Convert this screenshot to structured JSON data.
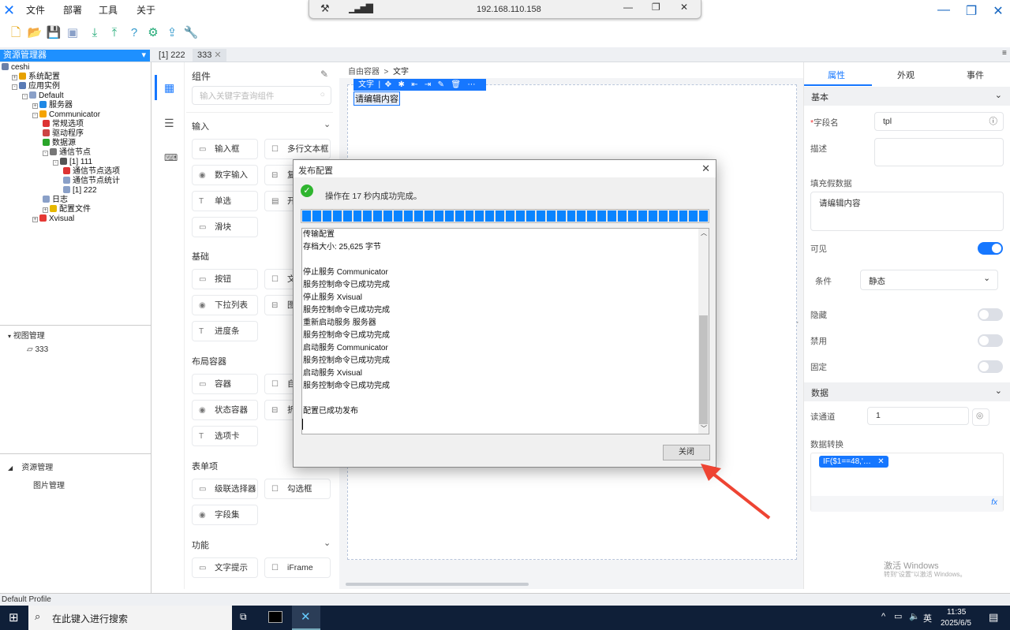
{
  "app": {
    "menus": [
      "文件",
      "部署",
      "工具",
      "关于"
    ],
    "accent": "#1677ff"
  },
  "remote": {
    "address": "192.168.110.158"
  },
  "explorer": {
    "title": "资源管理器",
    "tree": [
      {
        "label": "ceshi",
        "depth": 0,
        "icon": "project-icon",
        "color": "#6a7fa8",
        "exp": ""
      },
      {
        "label": "系统配置",
        "depth": 1,
        "icon": "config-icon",
        "color": "#e6a100",
        "exp": "+"
      },
      {
        "label": "应用实例",
        "depth": 1,
        "icon": "instance-icon",
        "color": "#5a7bb5",
        "exp": "-"
      },
      {
        "label": "Default",
        "depth": 2,
        "icon": "device-icon",
        "color": "#8aa0c8",
        "exp": "-"
      },
      {
        "label": "服务器",
        "depth": 3,
        "icon": "globe-icon",
        "color": "#1e88e5",
        "exp": "+"
      },
      {
        "label": "Communicator",
        "depth": 3,
        "icon": "gear-icon",
        "color": "#f5a300",
        "exp": "-"
      },
      {
        "label": "常规选项",
        "depth": 4,
        "icon": "options-icon",
        "color": "#d33",
        "exp": ""
      },
      {
        "label": "驱动程序",
        "depth": 4,
        "icon": "driver-icon",
        "color": "#c44",
        "exp": ""
      },
      {
        "label": "数据源",
        "depth": 4,
        "icon": "datasource-icon",
        "color": "#2aa52a",
        "exp": ""
      },
      {
        "label": "通信节点",
        "depth": 4,
        "icon": "node-icon",
        "color": "#777",
        "exp": "-"
      },
      {
        "label": "[1] 111",
        "depth": 5,
        "icon": "channel-icon",
        "color": "#555",
        "exp": "-"
      },
      {
        "label": "通信节点选项",
        "depth": 6,
        "icon": "options-icon",
        "color": "#d33",
        "exp": ""
      },
      {
        "label": "通信节点统计",
        "depth": 6,
        "icon": "document-icon",
        "color": "#8aa0c8",
        "exp": ""
      },
      {
        "label": "[1] 222",
        "depth": 6,
        "icon": "link-icon",
        "color": "#8aa0c8",
        "exp": ""
      },
      {
        "label": "日志",
        "depth": 4,
        "icon": "document-icon",
        "color": "#8aa0c8",
        "exp": ""
      },
      {
        "label": "配置文件",
        "depth": 4,
        "icon": "folder-icon",
        "color": "#e6b800",
        "exp": "+"
      },
      {
        "label": "Xvisual",
        "depth": 3,
        "icon": "chrome-icon",
        "color": "#e53935",
        "exp": "+"
      }
    ],
    "view_mgmt": "视图管理",
    "view_item": "333",
    "res_mgmt": "资源管理",
    "img_mgmt": "图片管理"
  },
  "tabs": [
    "[1] 222",
    "333"
  ],
  "components": {
    "title": "组件",
    "search_placeholder": "输入关键字查询组件",
    "sections": [
      {
        "title": "输入",
        "items": [
          [
            "输入框",
            "多行文本框"
          ],
          [
            "数字输入",
            "复"
          ],
          [
            "单选",
            "开"
          ],
          [
            "滑块"
          ]
        ]
      },
      {
        "title": "基础",
        "items": [
          [
            "按钮",
            "文"
          ],
          [
            "下拉列表",
            "图"
          ],
          [
            "进度条"
          ]
        ]
      },
      {
        "title": "布局容器",
        "items": [
          [
            "容器",
            "自"
          ],
          [
            "状态容器",
            "折"
          ],
          [
            "选项卡"
          ]
        ]
      },
      {
        "title": "表单项",
        "items": [
          [
            "级联选择器",
            "勾选框"
          ],
          [
            "字段集"
          ]
        ]
      },
      {
        "title": "功能",
        "items": [
          [
            "文字提示",
            "iFrame"
          ]
        ]
      }
    ]
  },
  "canvas": {
    "breadcrumb": [
      "自由容器",
      "文字"
    ],
    "selected_label": "文字",
    "text": "请编辑内容"
  },
  "props": {
    "tabs": [
      "属性",
      "外观",
      "事件"
    ],
    "active_tab": 0,
    "basic": "基本",
    "field_name_label": "字段名",
    "field_name": "tpl",
    "desc_label": "描述",
    "desc": "",
    "fake_label": "填充假数据",
    "fake_value": "请编辑内容",
    "visible_label": "可见",
    "visible": true,
    "cond_label": "条件",
    "cond_value": "静态",
    "hidden_label": "隐藏",
    "hidden": false,
    "disabled_label": "禁用",
    "disabled": false,
    "fixed_label": "固定",
    "fixed": false,
    "data": "数据",
    "read_label": "读通道",
    "read_value": "1",
    "transform_label": "数据转换",
    "transform_tag": "IF($1==48,'…"
  },
  "watermark": {
    "title": "激活 Windows",
    "sub": "转到\"设置\"以激活 Windows。"
  },
  "status": "Default Profile",
  "taskbar": {
    "search": "在此键入进行搜索",
    "time": "11:35",
    "date": "2025/6/5",
    "ime": "英"
  },
  "dialog": {
    "title": "发布配置",
    "message": "操作在 17 秒内成功完成。",
    "progress": 100,
    "log": [
      "传输配置",
      "存档大小: 25,625 字节",
      "",
      "停止服务 Communicator",
      "服务控制命令已成功完成",
      "停止服务 Xvisual",
      "服务控制命令已成功完成",
      "重新启动服务 服务器",
      "服务控制命令已成功完成",
      "启动服务 Communicator",
      "服务控制命令已成功完成",
      "启动服务 Xvisual",
      "服务控制命令已成功完成",
      "",
      "配置已成功发布"
    ],
    "close": "关闭"
  }
}
